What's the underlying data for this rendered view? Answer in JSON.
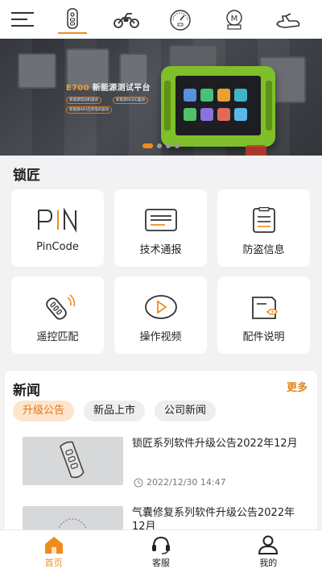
{
  "header": {
    "menu_icon": "hamburger-menu-icon",
    "categories": [
      {
        "icon": "car-key-icon",
        "active": true
      },
      {
        "icon": "motorcycle-icon",
        "active": false
      },
      {
        "icon": "speedometer-icon",
        "active": false
      },
      {
        "icon": "motor-badge-icon",
        "active": false
      },
      {
        "icon": "jet-ski-icon",
        "active": false
      }
    ],
    "accent_color": "#f08c1e"
  },
  "banner": {
    "title_model": "E700",
    "title_text": "新能源测试平台",
    "chips": [
      "新能源电动机驱动",
      "新能源DCDC驱动",
      "新能源48V启停电机驱动"
    ],
    "slide_count": 4,
    "active_slide": 1
  },
  "locksmith": {
    "title": "锁匠",
    "cards": [
      {
        "label": "PinCode",
        "icon": "pin-code-icon"
      },
      {
        "label": "技术通报",
        "icon": "news-bulletin-icon"
      },
      {
        "label": "防盗信息",
        "icon": "clipboard-icon"
      },
      {
        "label": "遥控匹配",
        "icon": "remote-key-icon"
      },
      {
        "label": "操作视频",
        "icon": "play-video-icon"
      },
      {
        "label": "配件说明",
        "icon": "accessory-tag-icon"
      }
    ]
  },
  "news": {
    "title": "新闻",
    "more": "更多",
    "tabs": [
      "升级公告",
      "新品上市",
      "公司新闻"
    ],
    "active_tab": 0,
    "items": [
      {
        "title": "锁匠系列软件升级公告2022年12月",
        "time": "2022/12/30 14:47",
        "thumb_icon": "car-key-fob-icon"
      },
      {
        "title": "气囊修复系列软件升级公告2022年12月",
        "time": "",
        "thumb_icon": "gauge-dial-icon"
      }
    ]
  },
  "bottom_nav": [
    {
      "label": "首页",
      "icon": "home-icon",
      "active": true
    },
    {
      "label": "客服",
      "icon": "headset-icon",
      "active": false
    },
    {
      "label": "我的",
      "icon": "user-icon",
      "active": false
    }
  ]
}
